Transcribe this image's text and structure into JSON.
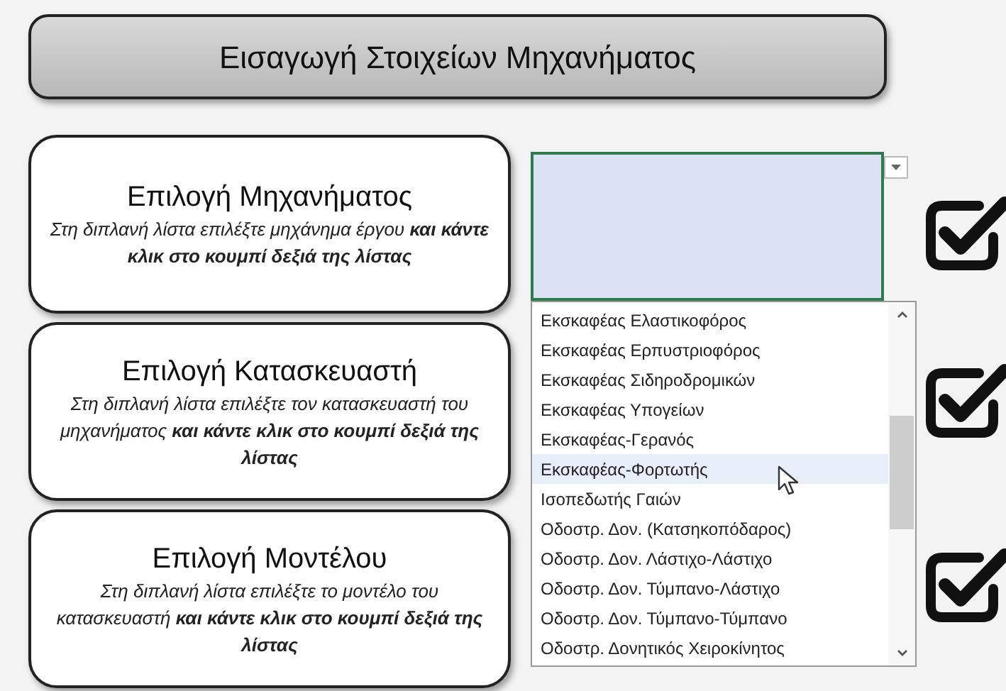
{
  "title": "Εισαγωγή Στοιχείων Μηχανήματος",
  "steps": [
    {
      "title": "Επιλογή Μηχανήματος",
      "text": "Στη διπλανή λίστα επιλέξτε μηχάνημα έργου **και κάντε κλικ στο κουμπί δεξιά της λίστας**",
      "checked": true
    },
    {
      "title": "Επιλογή Κατασκευαστή",
      "text": "Στη διπλανή λίστα επιλέξτε τον κατασκευαστή του μηχανήματος **και κάντε κλικ στο κουμπί δεξιά της λίστας**",
      "checked": true
    },
    {
      "title": "Επιλογή Μοντέλου",
      "text": "Στη διπλανή λίστα επιλέξτε το μοντέλο του κατασκευαστή **και κάντε κλικ στο κουμπί δεξιά της λίστας**",
      "checked": true
    }
  ],
  "dropdown": {
    "items": [
      {
        "label": "Εκσκαφέας Ελαστικοφόρος",
        "selected": false
      },
      {
        "label": "Εκσκαφέας Ερπυστριοφόρος",
        "selected": false
      },
      {
        "label": "Εκσκαφέας Σιδηροδρομικών",
        "selected": false
      },
      {
        "label": "Εκσκαφέας Υπογείων",
        "selected": false
      },
      {
        "label": "Εκσκαφέας-Γερανός",
        "selected": false
      },
      {
        "label": "Εκσκαφέας-Φορτωτής",
        "selected": true
      },
      {
        "label": "Ισοπεδωτής Γαιών",
        "selected": false
      },
      {
        "label": "Οδοστρ. Δον. (Κατσηκοπόδαρος)",
        "selected": false
      },
      {
        "label": "Οδοστρ. Δον. Λάστιχο-Λάστιχο",
        "selected": false
      },
      {
        "label": "Οδοστρ. Δον. Τύμπανο-Λάστιχο",
        "selected": false
      },
      {
        "label": "Οδοστρ. Δον. Τύμπανο-Τύμπανο",
        "selected": false
      },
      {
        "label": "Οδοστρ. Δονητικός Χειροκίνητος",
        "selected": false
      }
    ]
  }
}
